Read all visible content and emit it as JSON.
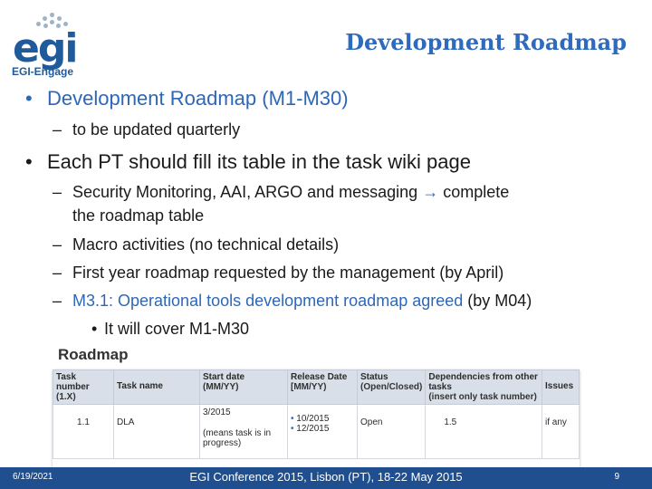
{
  "header": {
    "logo_mark": "egi",
    "logo_sub": "EGI-Engage",
    "title": "Development Roadmap"
  },
  "bullets": [
    {
      "text": "Development Roadmap (M1-M30)",
      "color": "#2d67b8"
    },
    {
      "text": "to be updated quarterly"
    },
    {
      "text": "Each PT should fill its table in the task wiki page",
      "color": "#1a1a1a"
    },
    {
      "text_a": "Security Monitoring, AAI, ARGO and messaging",
      "text_b": "complete",
      "text_c": "the roadmap table"
    },
    {
      "text": "Macro activities (no technical details)"
    },
    {
      "text": "First year roadmap requested by the management (by April)"
    },
    {
      "text_a": "M3.1: Operational tools development roadmap agreed",
      "text_b": "(by M04)"
    },
    {
      "text": "It will cover M1-M30"
    }
  ],
  "roadmap": {
    "label": "Roadmap",
    "headers": [
      {
        "title": "Task number",
        "sub": "(1.X)"
      },
      {
        "title": "Task name",
        "sub": ""
      },
      {
        "title": "Start date",
        "sub": "(MM/YY)"
      },
      {
        "title": "Release Date",
        "sub": "[MM/YY)"
      },
      {
        "title": "Status",
        "sub": "(Open/Closed)"
      },
      {
        "title": "Dependencies from other tasks",
        "sub": "(insert only task number)"
      },
      {
        "title": "Issues",
        "sub": ""
      }
    ],
    "row": {
      "task_number": "1.1",
      "task_name": "DLA",
      "start_date": "3/2015",
      "start_note": "(means task is in progress)",
      "release_1": "10/2015",
      "release_2": "12/2015",
      "status": "Open",
      "dependencies": "1.5",
      "issues": "if any"
    }
  },
  "footer": {
    "date": "6/19/2021",
    "text": "EGI Conference 2015, Lisbon (PT), 18-22 May 2015",
    "page": "9"
  }
}
